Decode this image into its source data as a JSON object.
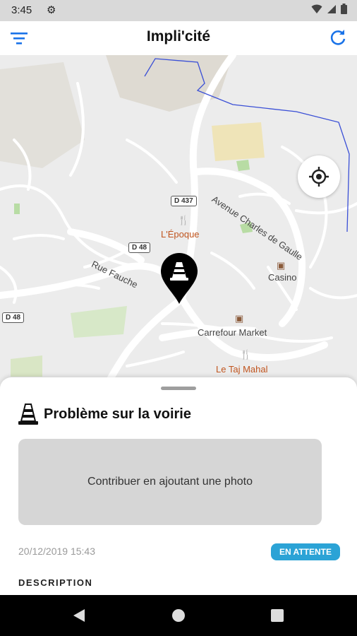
{
  "status_bar": {
    "time": "3:45",
    "icons": [
      "gear-icon",
      "wifi-icon",
      "signal-icon",
      "battery-icon"
    ]
  },
  "app_bar": {
    "title": "Impli'cité",
    "filter_icon": "filter-icon",
    "refresh_icon": "refresh-icon",
    "accent": "#1a73e8"
  },
  "map": {
    "road_badges": [
      "D 437",
      "D 48",
      "D 48"
    ],
    "street_labels": [
      "Avenue Charles de Gaulle",
      "Rue Fauche"
    ],
    "pois": [
      {
        "name": "L'Époque",
        "type": "restaurant"
      },
      {
        "name": "Casino",
        "type": "shop"
      },
      {
        "name": "Carrefour Market",
        "type": "shop"
      },
      {
        "name": "Le Taj Mahal",
        "type": "restaurant"
      }
    ],
    "marker_icon": "traffic-cone-icon",
    "locate_icon": "crosshair-icon"
  },
  "sheet": {
    "title": "Problème sur la voirie",
    "photo_placeholder": "Contribuer en ajoutant une photo",
    "date": "20/12/2019 15:43",
    "status": "EN ATTENTE",
    "status_color": "#2ba3d6",
    "description_label": "DESCRIPTION"
  },
  "nav_bar": {
    "buttons": [
      "back-icon",
      "home-icon",
      "recents-icon"
    ]
  }
}
